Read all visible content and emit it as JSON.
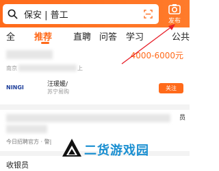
{
  "search": {
    "query": "保安 | 普工"
  },
  "header": {
    "publish_label": "发布"
  },
  "tabs": [
    {
      "label": "全"
    },
    {
      "label": "推荐"
    },
    {
      "label": "直聘"
    },
    {
      "label": "问答"
    },
    {
      "label": "学习"
    },
    {
      "label": "公共"
    }
  ],
  "job1": {
    "salary": "4000-6000元",
    "location_prefix": "南京",
    "location_suffix": "上",
    "company_logo_text": "NINGI",
    "company_name": "汪瑗媛/",
    "company_sub": "苏宁易购",
    "follow_label": "关注"
  },
  "job2": {
    "right_text": "员",
    "meta": "今日招聘官方 · 警|"
  },
  "job3": {
    "title": "收银员"
  },
  "watermark": {
    "text": "二货游戏园"
  },
  "colors": {
    "accent": "#ff6a1a",
    "watermark": "#1a8fd1",
    "annotation": "#e8202a"
  }
}
